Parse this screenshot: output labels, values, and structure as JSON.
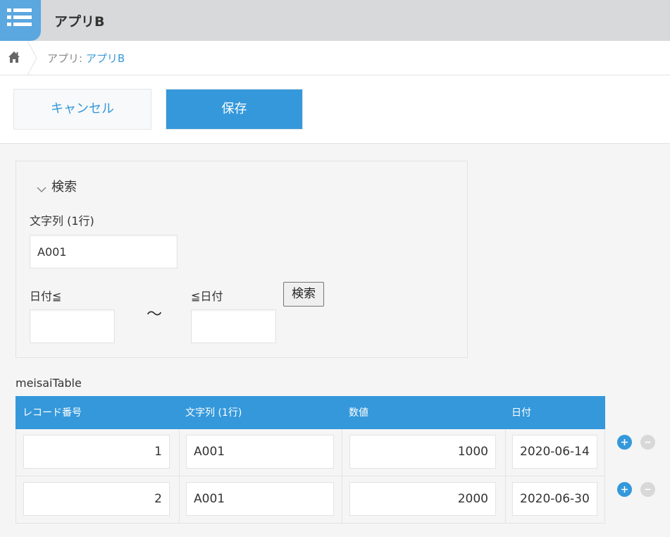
{
  "app": {
    "title": "アプリB",
    "icon": "list-icon"
  },
  "breadcrumb": {
    "home_icon": "home-icon",
    "prefix": "アプリ: ",
    "link": "アプリB"
  },
  "actions": {
    "cancel_label": "キャンセル",
    "save_label": "保存"
  },
  "search_group": {
    "title": "検索",
    "text_field_label": "文字列 (1行)",
    "text_field_value": "A001",
    "date_from_label": "日付≦",
    "date_from_value": "",
    "range_separator": "～",
    "date_to_label": "≦日付",
    "date_to_value": "",
    "search_button": "検索"
  },
  "table": {
    "label": "meisaiTable",
    "headers": [
      "レコード番号",
      "文字列 (1行)",
      "数値",
      "日付"
    ],
    "rows": [
      [
        "1",
        "A001",
        "1000",
        "2020-06-14"
      ],
      [
        "2",
        "A001",
        "2000",
        "2020-06-30"
      ]
    ]
  },
  "colors": {
    "accent": "#3498db",
    "topbar": "#d7d9da",
    "background": "#f5f5f5"
  }
}
